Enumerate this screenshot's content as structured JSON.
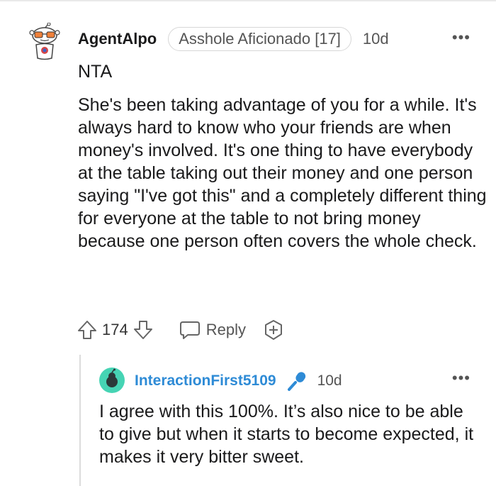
{
  "comment": {
    "username": "AgentAlpo",
    "flair": "Asshole Aficionado [17]",
    "time": "10d",
    "more": "•••",
    "verdict": "NTA",
    "body": "She's been taking advantage of you for a while. It's always hard to know who your friends are when money's involved. It's one thing to have everybody at the table taking out their money and one person saying \"I've got this\" and a completely different thing for everyone at the table to not bring money because one person often covers the whole check.",
    "score": "174",
    "reply_label": "Reply"
  },
  "reply": {
    "username": "InteractionFirst5109",
    "time": "10d",
    "more": "•••",
    "body": "I agree with this 100%. It’s also nice to be able to give but when it starts to become expected, it makes it very bitter sweet."
  },
  "colors": {
    "username_blue": "#2e8bd6",
    "avatar_teal": "#46d4b4",
    "text": "#1a1a1b",
    "muted": "#555555"
  },
  "icons": [
    "snoo-avatar-icon",
    "more-options-icon",
    "upvote-icon",
    "downvote-icon",
    "reply-bubble-icon",
    "award-icon",
    "microphone-icon"
  ]
}
